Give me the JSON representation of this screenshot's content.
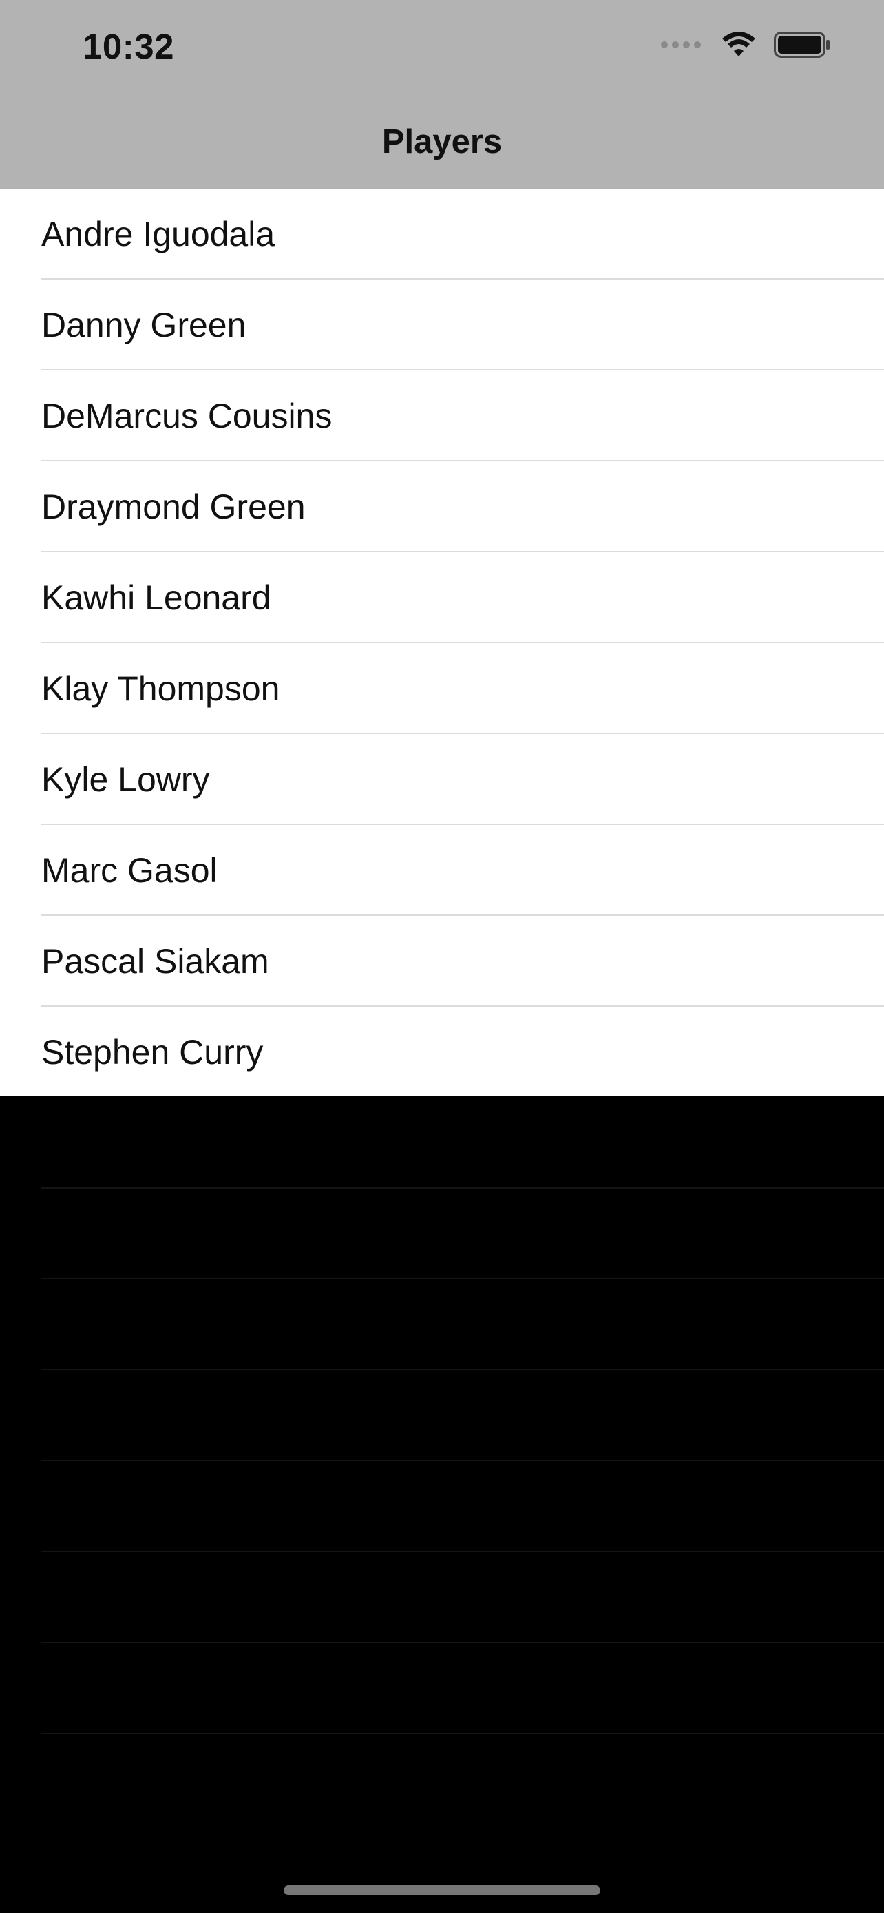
{
  "status_bar": {
    "time": "10:32"
  },
  "nav_bar": {
    "title": "Players"
  },
  "players": [
    "Andre Iguodala",
    "Danny Green",
    "DeMarcus Cousins",
    "Draymond Green",
    "Kawhi Leonard",
    "Klay Thompson",
    "Kyle Lowry",
    "Marc Gasol",
    "Pascal Siakam",
    "Stephen Curry"
  ],
  "icons": [
    "cellular-signal-icon",
    "wifi-icon",
    "battery-icon"
  ],
  "colors": {
    "header_bg": "#b3b3b3",
    "list_bg": "#ffffff",
    "page_bg": "#000000",
    "separator": "#dcdcdc"
  }
}
